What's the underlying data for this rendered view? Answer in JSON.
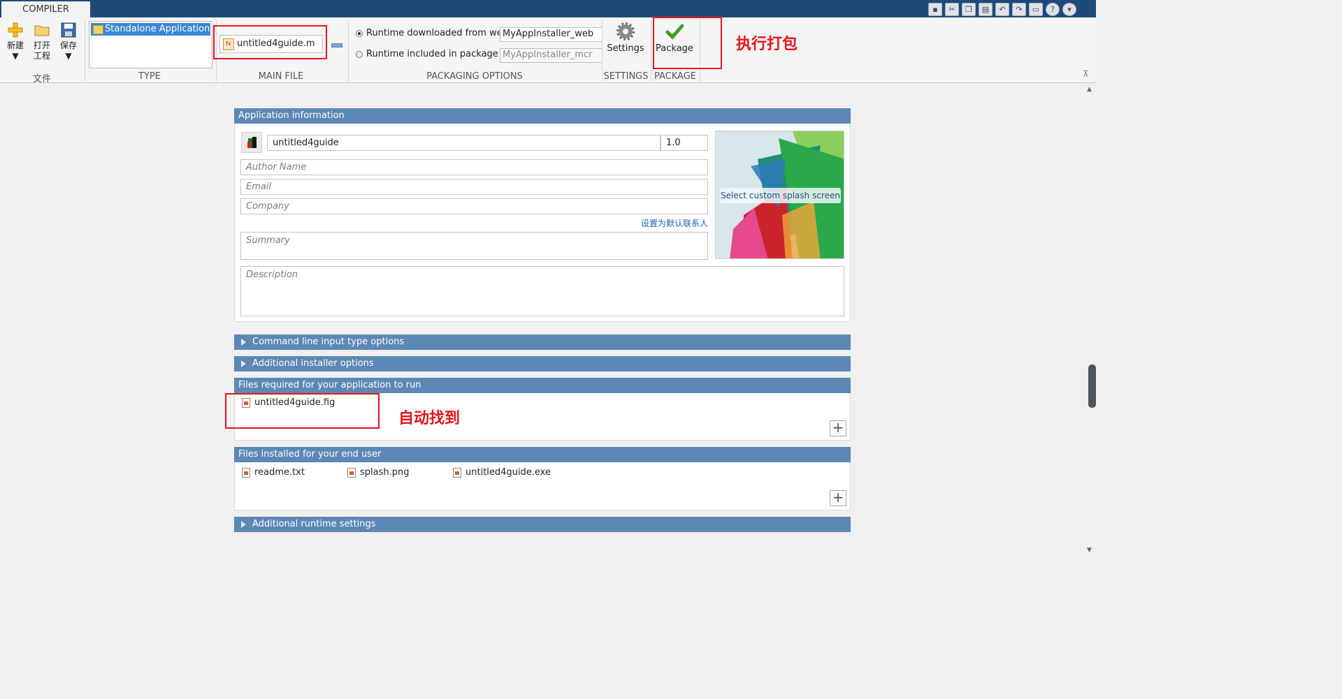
{
  "toolstrip": {
    "tab": "COMPILER",
    "quick_access_icons": [
      "save-icon",
      "cut-icon",
      "copy-icon",
      "paste-icon",
      "undo-icon",
      "redo-icon",
      "switch-windows-icon",
      "help-icon",
      "options-icon"
    ]
  },
  "file_section": {
    "label": "文件",
    "new_label": "新建",
    "open_label_line1": "打开",
    "open_label_line2": "工程",
    "save_label": "保存"
  },
  "type_section": {
    "label": "TYPE",
    "selected": "Standalone Application"
  },
  "main_file_section": {
    "label": "MAIN FILE",
    "file": "untitled4guide.m"
  },
  "packaging_options": {
    "label": "PACKAGING OPTIONS",
    "option_web": "Runtime downloaded from web",
    "option_web_value": "MyAppInstaller_web",
    "option_pkg": "Runtime included in package",
    "option_pkg_value": "MyAppInstaller_mcr",
    "selected": "web"
  },
  "settings_section": {
    "label": "SETTINGS",
    "button": "Settings"
  },
  "package_section": {
    "label": "PACKAGE",
    "button": "Package"
  },
  "annotations": {
    "package_note": "执行打包",
    "files_note": "自动找到"
  },
  "app_info": {
    "header": "Application information",
    "app_name": "untitled4guide",
    "version": "1.0",
    "author_placeholder": "Author Name",
    "email_placeholder": "Email",
    "company_placeholder": "Company",
    "default_contact_link": "设置为默认联系人",
    "summary_placeholder": "Summary",
    "description_placeholder": "Description",
    "splash_button": "Select custom splash screen"
  },
  "sections": {
    "cmdline": "Command line input type options",
    "installer": "Additional installer options",
    "files_required_header": "Files required for your application to run",
    "files_required": [
      "untitled4guide.fig"
    ],
    "files_installed_header": "Files installed for your end user",
    "files_installed": [
      "readme.txt",
      "splash.png",
      "untitled4guide.exe"
    ],
    "runtime": "Additional runtime settings"
  },
  "colors": {
    "panel_header": "#5d88b6",
    "title_bar": "#1e4a7a",
    "selection": "#3a87d6",
    "annotation": "#e8141b"
  }
}
